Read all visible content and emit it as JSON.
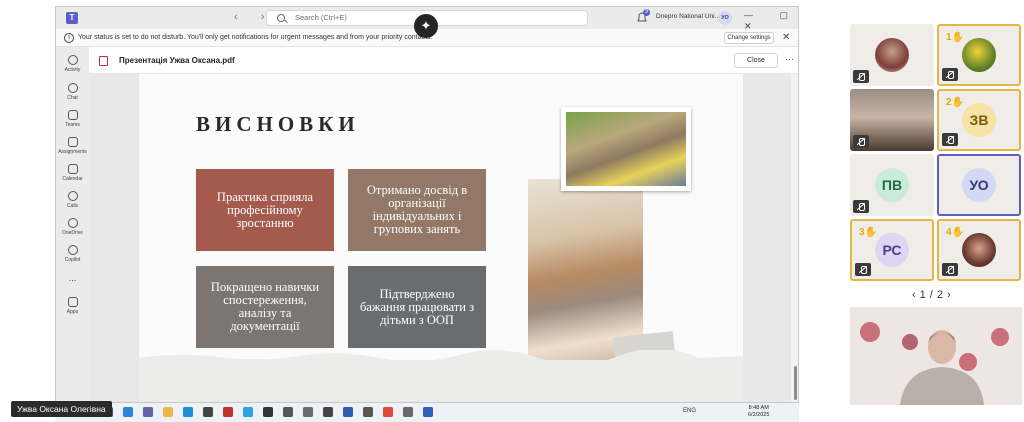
{
  "window": {
    "search_placeholder": "Search (Ctrl+E)",
    "org_name": "Dnepro National Uni...",
    "user_initials": "УО",
    "notification_count": "9",
    "copilot_icon": "sparkle-icon"
  },
  "notice": {
    "message": "Your status is set to do not disturb. You'll only get notifications for urgent messages and from your priority contacts.",
    "change_button": "Change settings"
  },
  "rail": [
    {
      "label": "Activity"
    },
    {
      "label": "Chat"
    },
    {
      "label": "Teams"
    },
    {
      "label": "Assignments"
    },
    {
      "label": "Calendar"
    },
    {
      "label": "Calls"
    },
    {
      "label": "OneDrive"
    },
    {
      "label": "Copilot"
    },
    {
      "label": "..."
    },
    {
      "label": "Apps"
    }
  ],
  "file": {
    "title": "Презентація Ужва Оксана.pdf",
    "close_label": "Close"
  },
  "slide": {
    "title": "ВИСНОВКИ",
    "cards": [
      {
        "text": "Практика сприяла професійному зростанню",
        "color": "#a45b4d"
      },
      {
        "text": "Отримано досвід в організації індивідуальних і групових занять",
        "color": "#937868"
      },
      {
        "text": "Покращено навички спостереження, аналізу та документації",
        "color": "#7d7570"
      },
      {
        "text": "Підтверджено бажання працювати з дітьми з ООП",
        "color": "#6a6d70"
      }
    ]
  },
  "taskbar": {
    "lang": "ENG",
    "time": "8:48 AM",
    "date": "6/2/2025"
  },
  "presenter_name": "Ужва Оксана Олегівна",
  "participants": [
    {
      "type": "photo",
      "hand": ""
    },
    {
      "type": "photo",
      "hand": "1"
    },
    {
      "type": "video",
      "hand": ""
    },
    {
      "type": "initials",
      "initials": "ЗВ",
      "hand": "2",
      "bg": "#f6e3a6",
      "fg": "#7a5a12"
    },
    {
      "type": "initials",
      "initials": "ПВ",
      "hand": "",
      "bg": "#c9ecd9",
      "fg": "#1f6b43"
    },
    {
      "type": "initials",
      "initials": "УО",
      "hand": "",
      "bg": "#d4d9f3",
      "fg": "#333a7a"
    },
    {
      "type": "initials",
      "initials": "РС",
      "hand": "3",
      "bg": "#dcd6f2",
      "fg": "#4b3f8e"
    },
    {
      "type": "photo",
      "hand": "4"
    }
  ],
  "pager": "1/2"
}
